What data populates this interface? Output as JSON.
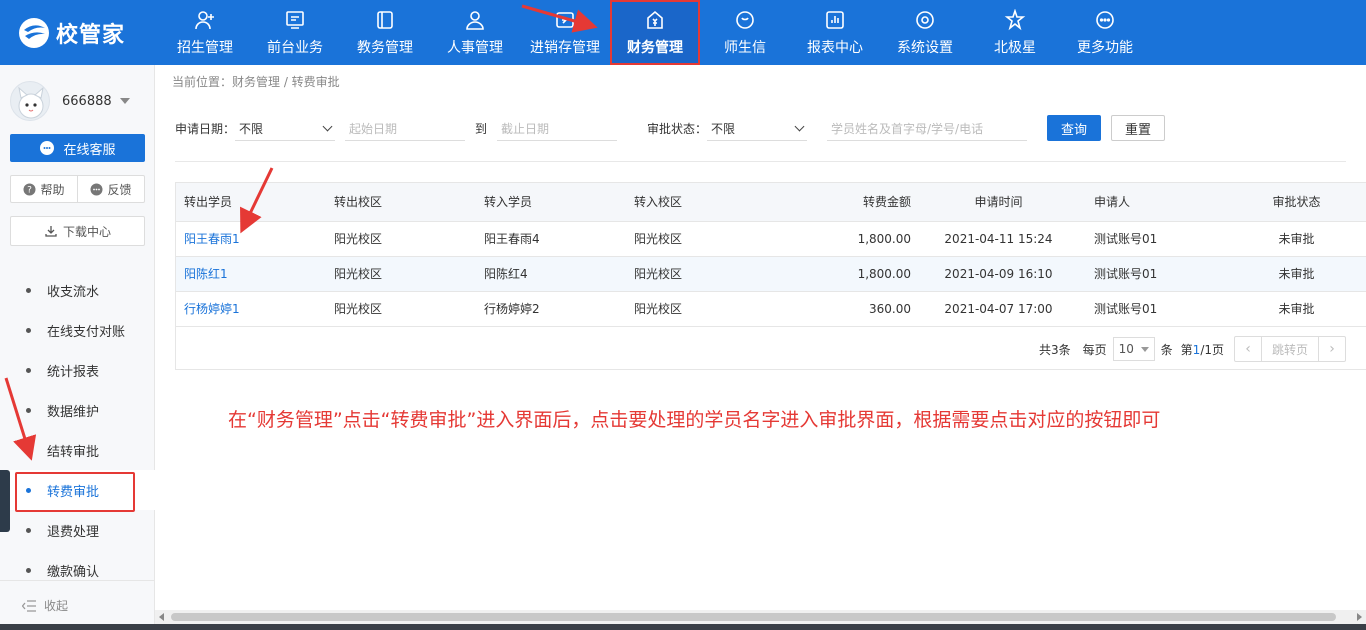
{
  "brand": {
    "name": "校管家"
  },
  "nav": [
    {
      "label": "招生管理",
      "icon": "person-add-icon"
    },
    {
      "label": "前台业务",
      "icon": "monitor-icon"
    },
    {
      "label": "教务管理",
      "icon": "book-icon"
    },
    {
      "label": "人事管理",
      "icon": "person-icon"
    },
    {
      "label": "进销存管理",
      "icon": "inventory-icon"
    },
    {
      "label": "财务管理",
      "icon": "finance-icon",
      "active": true
    },
    {
      "label": "师生信",
      "icon": "chat-icon"
    },
    {
      "label": "报表中心",
      "icon": "report-icon"
    },
    {
      "label": "系统设置",
      "icon": "settings-icon"
    },
    {
      "label": "北极星",
      "icon": "star-icon"
    },
    {
      "label": "更多功能",
      "icon": "more-icon"
    }
  ],
  "user": {
    "name": "666888"
  },
  "sidebar": {
    "service_label": "在线客服",
    "help_label": "帮助",
    "feedback_label": "反馈",
    "download_label": "下载中心",
    "items": [
      {
        "label": "收支流水"
      },
      {
        "label": "在线支付对账"
      },
      {
        "label": "统计报表"
      },
      {
        "label": "数据维护"
      },
      {
        "label": "结转审批"
      },
      {
        "label": "转费审批",
        "active": true
      },
      {
        "label": "退费处理"
      },
      {
        "label": "缴款确认"
      }
    ],
    "collapse_label": "收起"
  },
  "breadcrumb": "当前位置：财务管理 / 转费审批",
  "filters": {
    "apply_date_label": "申请日期：",
    "apply_date_value": "不限",
    "start_placeholder": "起始日期",
    "to_label": "到",
    "end_placeholder": "截止日期",
    "status_label": "审批状态：",
    "status_value": "不限",
    "search_placeholder": "学员姓名及首字母/学号/电话",
    "query_label": "查询",
    "reset_label": "重置"
  },
  "table": {
    "headers": [
      "转出学员",
      "转出校区",
      "转入学员",
      "转入校区",
      "转费金额",
      "申请时间",
      "申请人",
      "审批状态"
    ],
    "rows": [
      [
        "阳王春雨1",
        "阳光校区",
        "阳王春雨4",
        "阳光校区",
        "1,800.00",
        "2021-04-11 15:24",
        "测试账号01",
        "未审批"
      ],
      [
        "阳陈红1",
        "阳光校区",
        "阳陈红4",
        "阳光校区",
        "1,800.00",
        "2021-04-09 16:10",
        "测试账号01",
        "未审批"
      ],
      [
        "行杨婷婷1",
        "阳光校区",
        "行杨婷婷2",
        "阳光校区",
        "360.00",
        "2021-04-07 17:00",
        "测试账号01",
        "未审批"
      ]
    ]
  },
  "pager": {
    "total": "共3条",
    "per_page_label": "每页",
    "per_page_value": "10",
    "unit": "条",
    "page_prefix": "第",
    "page_current": "1",
    "page_suffix": "/1页",
    "prev": "‹",
    "jump_label": "跳转页",
    "next": "›"
  },
  "annotation": "在“财务管理”点击“转费审批”进入界面后，点击要处理的学员名字进入审批界面，根据需要点击对应的按钮即可",
  "colors": {
    "primary": "#1a73d9",
    "annotation": "#e53935"
  }
}
